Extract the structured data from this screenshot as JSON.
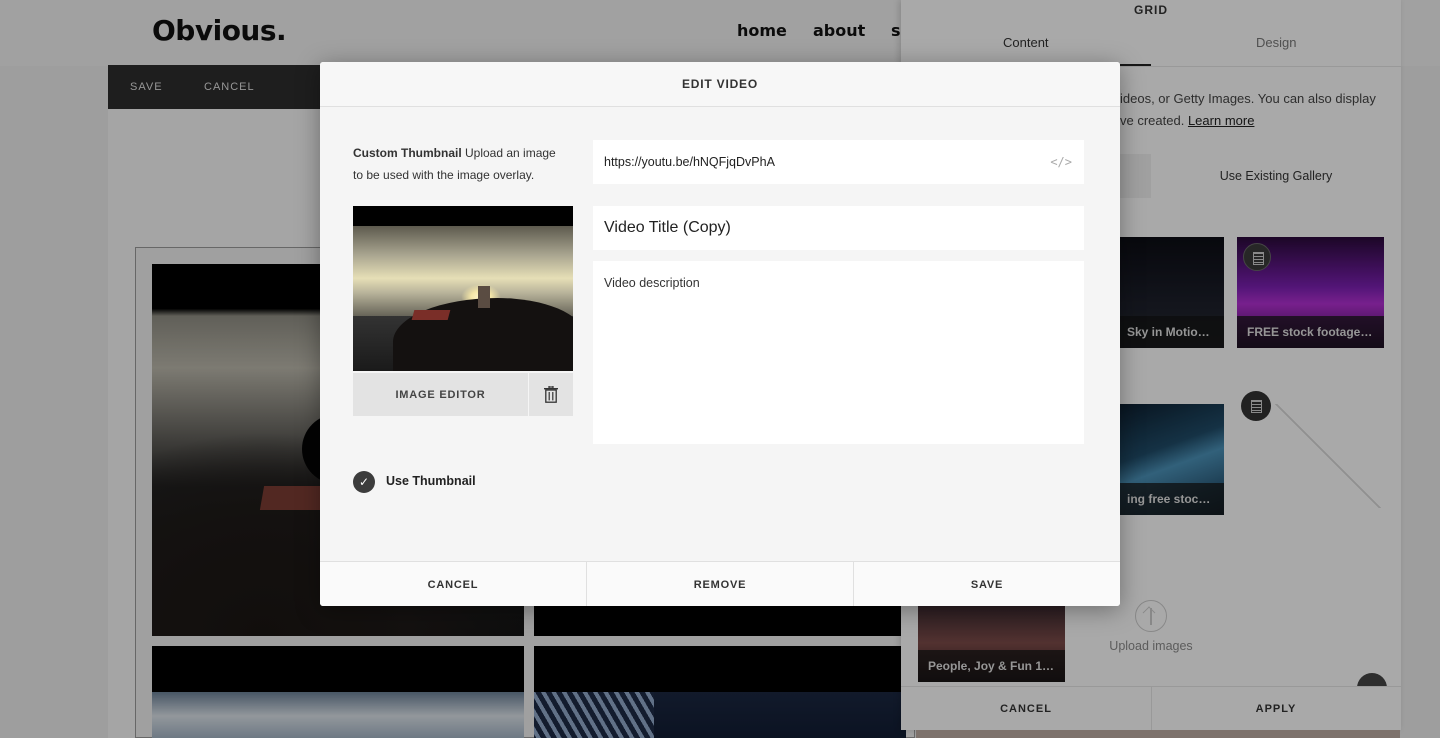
{
  "site": {
    "logo": "Obvious.",
    "nav": [
      "home",
      "about",
      "s"
    ]
  },
  "edit_bar": {
    "save": "SAVE",
    "cancel": "CANCEL"
  },
  "panel": {
    "title": "GRID",
    "tabs": {
      "content": "Content",
      "design": "Design"
    },
    "description_line1": "ideos, or Getty Images. You can also display",
    "description_line2": "ve created.",
    "learn_more": "Learn more",
    "use_existing_gallery": "Use Existing Gallery",
    "thumbnails": [
      "Sky in Motion & ...",
      "FREE stock footage Dj...",
      "ing free stock vi...",
      "People, Joy & Fun 10/1..."
    ],
    "upload_images": "Upload images",
    "footer": {
      "cancel": "CANCEL",
      "apply": "APPLY"
    }
  },
  "modal": {
    "title": "EDIT VIDEO",
    "help_bold": "Custom Thumbnail",
    "help_text": " Upload an image to be used with the image overlay.",
    "image_editor": "IMAGE EDITOR",
    "use_thumbnail": "Use Thumbnail",
    "url_value": "https://youtu.be/hNQFjqDvPhA",
    "code_icon": "</>",
    "title_value": "Video Title (Copy)",
    "description_value": "Video description",
    "footer": {
      "cancel": "CANCEL",
      "remove": "REMOVE",
      "save": "SAVE"
    }
  },
  "icons": {
    "trash": "trash-icon",
    "check": "check-icon",
    "code": "code-embed-icon",
    "film": "film-icon",
    "upload": "upload-arrow-icon"
  },
  "colors": {
    "overlay": "#000000",
    "dark_bar": "#2d2d2d",
    "check_circle": "#3c3c3c"
  }
}
